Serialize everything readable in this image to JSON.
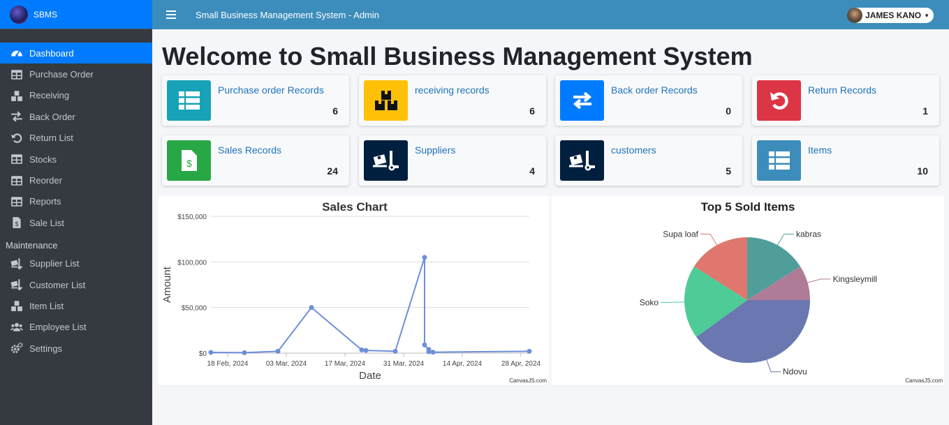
{
  "brand": {
    "name": "SBMS"
  },
  "topbar": {
    "title": "Small Business Management System - Admin",
    "user": "JAMES KANO"
  },
  "sidebar": {
    "items": [
      {
        "label": "Dashboard",
        "icon": "tachometer-icon",
        "active": true
      },
      {
        "label": "Purchase Order",
        "icon": "table-icon"
      },
      {
        "label": "Receiving",
        "icon": "boxes-icon"
      },
      {
        "label": "Back Order",
        "icon": "exchange-icon"
      },
      {
        "label": "Return List",
        "icon": "undo-icon"
      },
      {
        "label": "Stocks",
        "icon": "table-icon"
      },
      {
        "label": "Reorder",
        "icon": "table-icon"
      },
      {
        "label": "Reports",
        "icon": "table-icon"
      },
      {
        "label": "Sale List",
        "icon": "file-invoice-icon"
      }
    ],
    "maintenance_header": "Maintenance",
    "maintenance": [
      {
        "label": "Supplier List",
        "icon": "truck-loading-icon"
      },
      {
        "label": "Customer List",
        "icon": "truck-loading-icon"
      },
      {
        "label": "Item List",
        "icon": "boxes-icon"
      },
      {
        "label": "Employee List",
        "icon": "users-icon"
      },
      {
        "label": "Settings",
        "icon": "cogs-icon"
      }
    ]
  },
  "page": {
    "heading": "Welcome to Small Business Management System"
  },
  "cards": [
    {
      "label": "Purchase order Records",
      "value": "6",
      "icon": "table-icon",
      "color": "#17a2b8"
    },
    {
      "label": "receiving records",
      "value": "6",
      "icon": "boxes-icon",
      "color": "#ffc107"
    },
    {
      "label": "Back order Records",
      "value": "0",
      "icon": "exchange-icon",
      "color": "#007bff"
    },
    {
      "label": "Return Records",
      "value": "1",
      "icon": "undo-icon",
      "color": "#dc3545"
    },
    {
      "label": "Sales Records",
      "value": "24",
      "icon": "file-invoice-dollar-icon",
      "color": "#28a745"
    },
    {
      "label": "Suppliers",
      "value": "4",
      "icon": "truck-loading-icon",
      "color": "#001f3f"
    },
    {
      "label": "customers",
      "value": "5",
      "icon": "truck-loading-icon",
      "color": "#001f3f"
    },
    {
      "label": "Items",
      "value": "10",
      "icon": "table-icon",
      "color": "#3c8dbc"
    }
  ],
  "chart_data": [
    {
      "type": "line",
      "title": "Sales Chart",
      "xlabel": "Date",
      "ylabel": "Amount",
      "ylim": [
        0,
        150000
      ],
      "yticks": [
        "$0",
        "$50,000",
        "$100,000",
        "$150,000"
      ],
      "xlim": [
        "2024-02-14",
        "2024-04-30"
      ],
      "xticks": [
        "18 Feb, 2024",
        "03 Mar, 2024",
        "17 Mar, 2024",
        "31 Mar, 2024",
        "14 Apr, 2024",
        "28 Apr, 2024"
      ],
      "grid": true,
      "color": "#6d8fd8",
      "credit": "CanvasJS.com",
      "points": [
        {
          "x": "2024-02-14",
          "y": 800
        },
        {
          "x": "2024-02-22",
          "y": 500
        },
        {
          "x": "2024-03-01",
          "y": 2000
        },
        {
          "x": "2024-03-09",
          "y": 50000
        },
        {
          "x": "2024-03-21",
          "y": 3500
        },
        {
          "x": "2024-03-22",
          "y": 3000
        },
        {
          "x": "2024-03-29",
          "y": 2000
        },
        {
          "x": "2024-04-05",
          "y": 105000
        },
        {
          "x": "2024-04-05",
          "y": 9000
        },
        {
          "x": "2024-04-06",
          "y": 4000
        },
        {
          "x": "2024-04-06",
          "y": 1500
        },
        {
          "x": "2024-04-07",
          "y": 1000
        },
        {
          "x": "2024-04-30",
          "y": 2000
        }
      ]
    },
    {
      "type": "pie",
      "title": "Top 5 Sold Items",
      "credit": "CanvasJS.com",
      "slices": [
        {
          "label": "kabras",
          "value": 16,
          "color": "#4f9e9a"
        },
        {
          "label": "Kingsleymill",
          "value": 9,
          "color": "#b07b96"
        },
        {
          "label": "Ndovu",
          "value": 40,
          "color": "#6b77b0"
        },
        {
          "label": "Soko",
          "value": 19,
          "color": "#4ecb96"
        },
        {
          "label": "Supa loaf",
          "value": 16,
          "color": "#e0776f"
        }
      ]
    }
  ]
}
